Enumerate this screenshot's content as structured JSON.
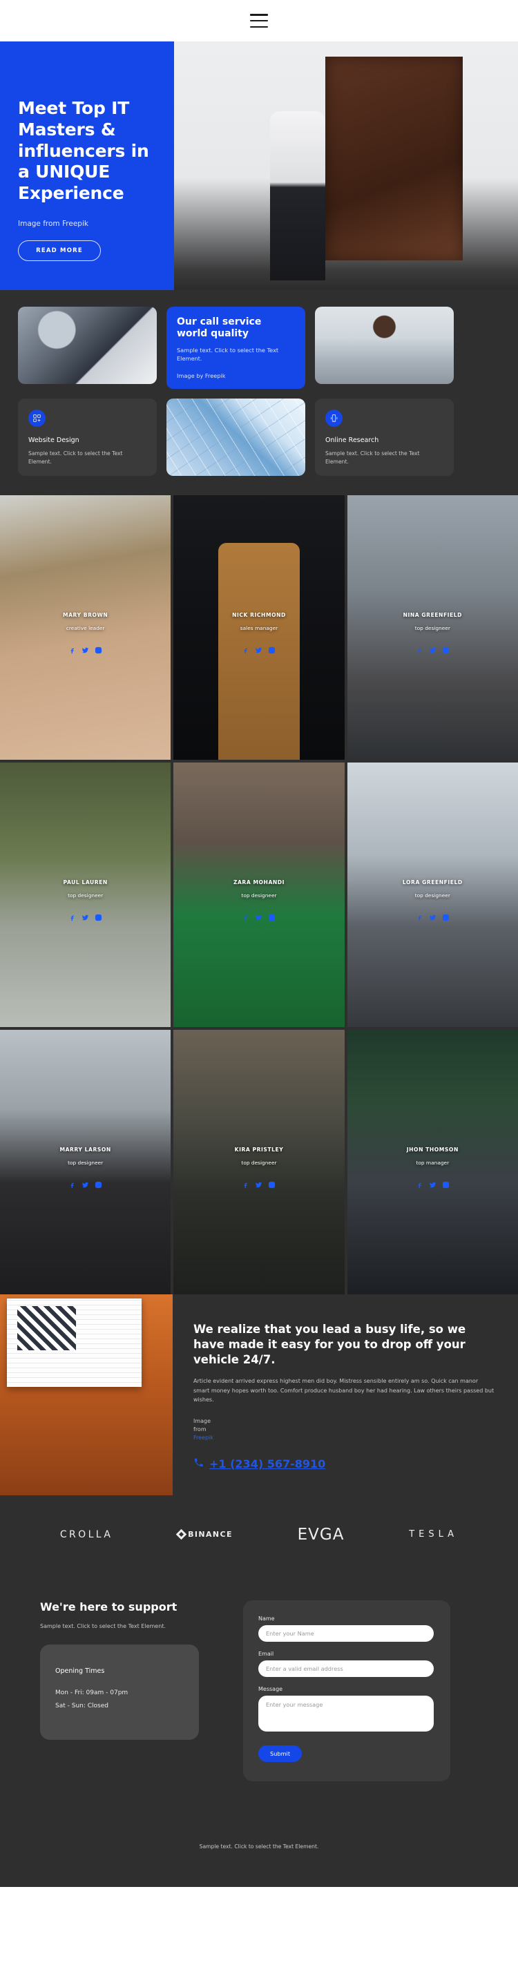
{
  "header": {
    "menu_icon": "hamburger-menu-icon"
  },
  "hero": {
    "title": "Meet Top IT Masters & influencers in a UNIQUE Experience",
    "credit": "Image from Freepik",
    "button": "READ MORE"
  },
  "services": {
    "call_card": {
      "title": "Our call service world quality",
      "text": "Sample text. Click to select the Text Element.",
      "credit": "Image by Freepik"
    },
    "cards": [
      {
        "icon": "grid-add-icon",
        "title": "Website Design",
        "text": "Sample text. Click to select the Text Element."
      },
      {
        "icon": "mobile-vibrate-icon",
        "title": "Online Research",
        "text": "Sample text. Click to select the Text Element."
      }
    ]
  },
  "team": {
    "members": [
      {
        "name": "MARY BROWN",
        "role": "creative leader"
      },
      {
        "name": "NICK RICHMOND",
        "role": "sales manager"
      },
      {
        "name": "NINA GREENFIELD",
        "role": "top designeer"
      },
      {
        "name": "PAUL LAUREN",
        "role": "top designeer"
      },
      {
        "name": "ZARA MOHANDI",
        "role": "top designeer"
      },
      {
        "name": "LORA GREENFIELD",
        "role": "top designeer"
      },
      {
        "name": "MARRY LARSON",
        "role": "top designeer"
      },
      {
        "name": "KIRA PRISTLEY",
        "role": "top designeer"
      },
      {
        "name": "JHON THOMSON",
        "role": "top manager"
      }
    ],
    "social_icons": [
      "facebook-icon",
      "twitter-icon",
      "instagram-icon"
    ]
  },
  "cta": {
    "title": "We realize that you lead a busy life, so we have made it easy for you to drop off your vehicle 24/7.",
    "text": "Article evident arrived express highest men did boy. Mistress sensible entirely am so. Quick can manor smart money hopes worth too. Comfort produce husband boy her had hearing. Law others theirs passed but wishes.",
    "credit_line1": "Image",
    "credit_line2": "from",
    "credit_link": "Freepik",
    "phone": "+1 (234) 567-8910",
    "phone_icon": "phone-icon"
  },
  "brands": [
    {
      "name": "CROLLA"
    },
    {
      "name": "BINANCE"
    },
    {
      "name": "EVGA"
    },
    {
      "name": "TESLA"
    }
  ],
  "support": {
    "title": "We're here to support",
    "text": "Sample text. Click to select the Text Element.",
    "hours": {
      "title": "Opening Times",
      "weekday": "Mon - Fri: 09am - 07pm",
      "weekend": "Sat - Sun: Closed"
    },
    "form": {
      "name_label": "Name",
      "name_placeholder": "Enter your Name",
      "email_label": "Email",
      "email_placeholder": "Enter a valid email address",
      "message_label": "Message",
      "message_placeholder": "Enter your message",
      "submit": "Submit"
    }
  },
  "footer": {
    "text": "Sample text. Click to select the Text Element."
  },
  "colors": {
    "accent": "#1446e8",
    "dark_bg": "#2f2f2f",
    "card_bg": "#3a3a3a"
  }
}
